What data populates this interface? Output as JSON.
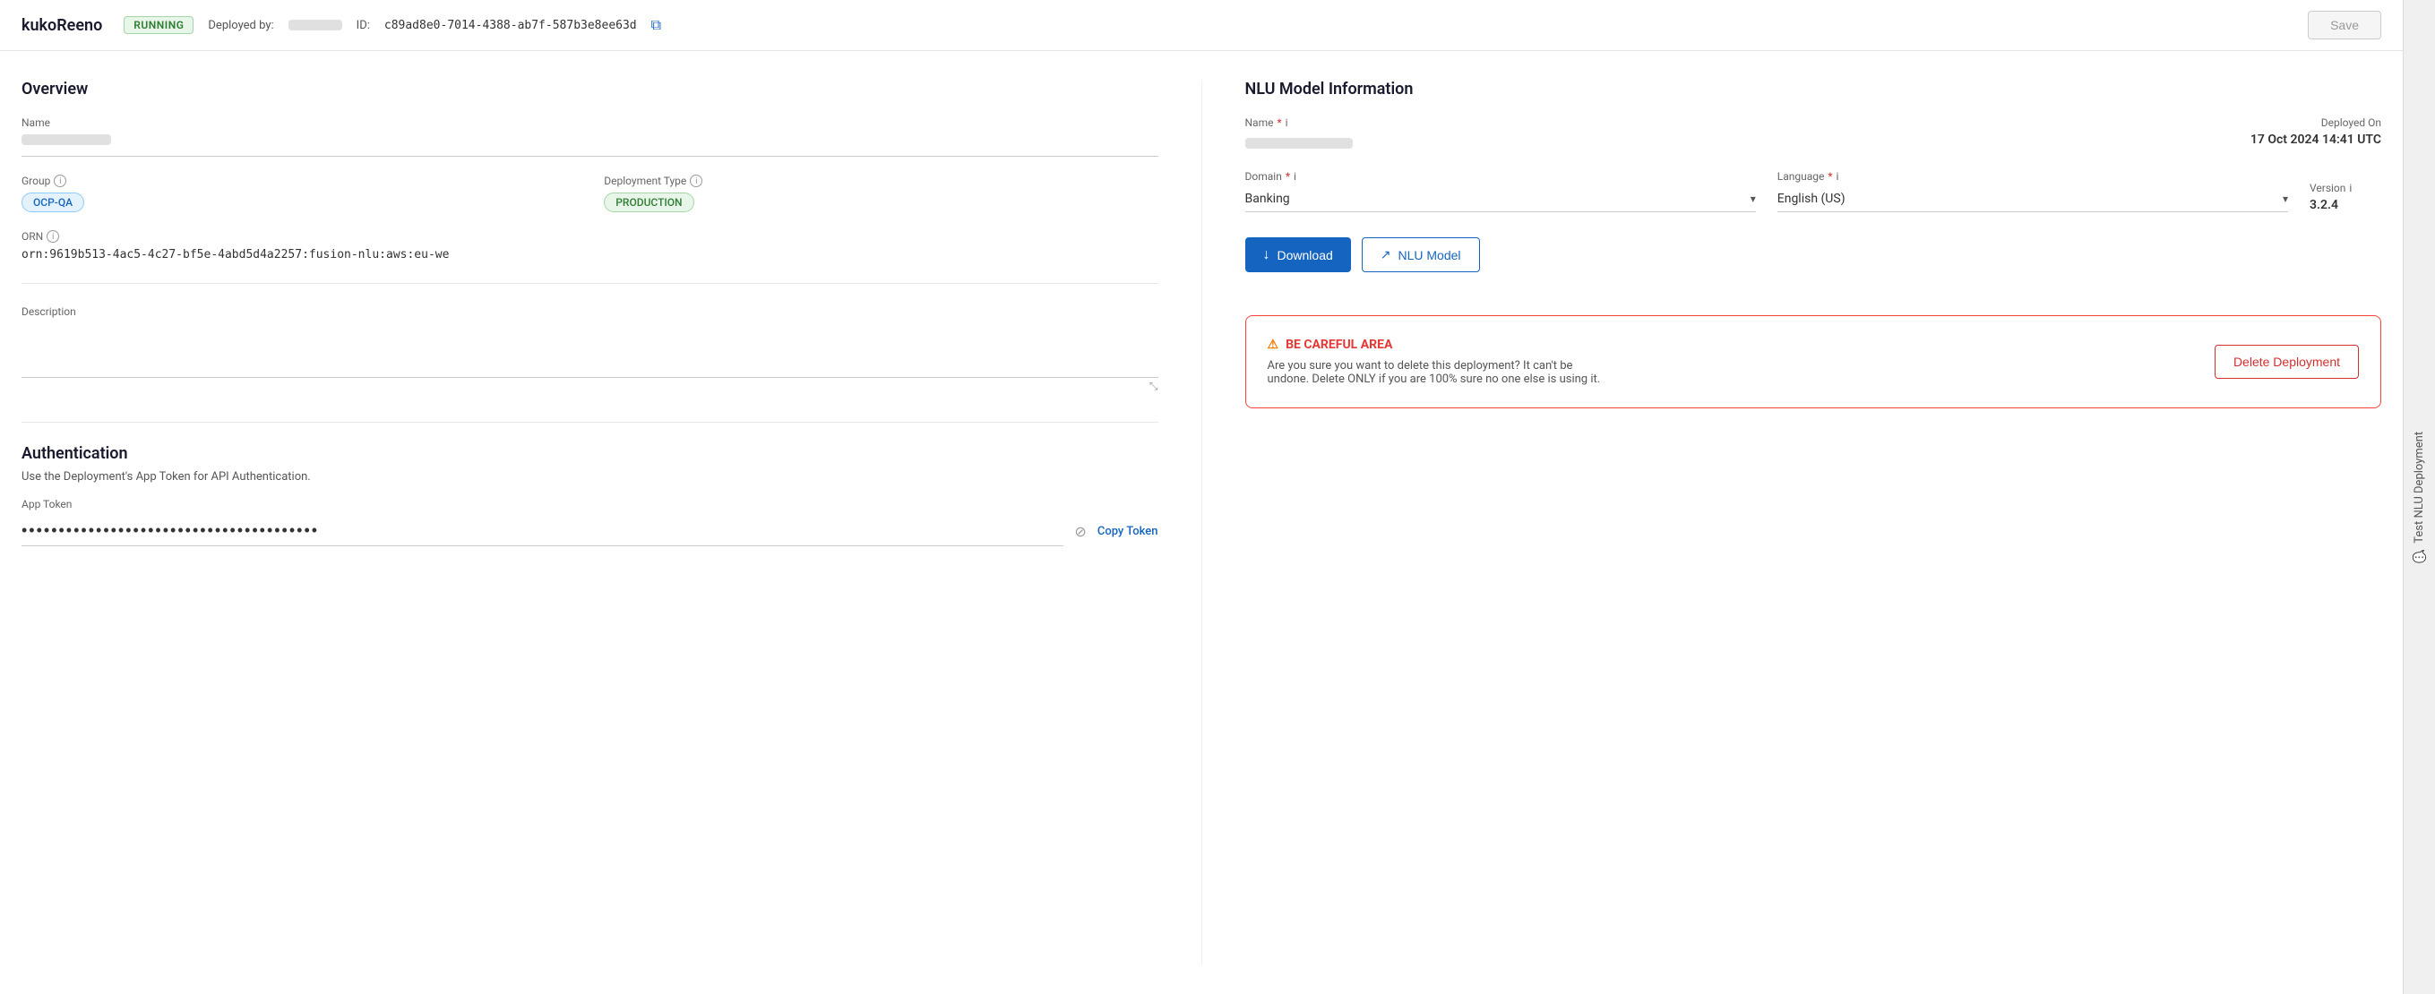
{
  "page": {
    "title": "kukoReeno",
    "sidebar_label": "Test NLU Deployment"
  },
  "top_bar": {
    "status": "RUNNING",
    "deployed_by_label": "Deployed by:",
    "id_label": "ID:",
    "id_value": "c89ad8e0-7014-4388-ab7f-587b3e8ee63d",
    "save_button": "Save"
  },
  "overview": {
    "section_title": "Overview",
    "name_label": "Name",
    "group_label": "Group",
    "group_info": "i",
    "group_value": "OCP-QA",
    "deployment_type_label": "Deployment Type",
    "deployment_type_info": "i",
    "deployment_type_value": "PRODUCTION",
    "orn_label": "ORN",
    "orn_info": "i",
    "orn_value": "orn:9619b513-4ac5-4c27-bf5e-4abd5d4a2257:fusion-nlu:aws:eu-we",
    "description_label": "Description"
  },
  "authentication": {
    "section_title": "Authentication",
    "description": "Use the Deployment's App Token for API Authentication.",
    "app_token_label": "App Token",
    "app_token_value": "••••••••••••••••••••••••••••••••••••••••",
    "copy_token_label": "Copy Token"
  },
  "nlu_model": {
    "section_title": "NLU Model Information",
    "name_label": "Name",
    "name_required": true,
    "name_info": "i",
    "deployed_on_label": "Deployed On",
    "deployed_on_value": "17 Oct 2024 14:41 UTC",
    "domain_label": "Domain",
    "domain_required": true,
    "domain_info": "i",
    "domain_value": "Banking",
    "language_label": "Language",
    "language_required": true,
    "language_info": "i",
    "language_value": "English (US)",
    "version_label": "Version",
    "version_info": "i",
    "version_value": "3.2.4",
    "download_button": "Download",
    "nlu_model_button": "NLU Model"
  },
  "danger_area": {
    "title": "BE CAREFUL AREA",
    "description": "Are you sure you want to delete this deployment? It can't be undone. Delete ONLY if you are 100% sure no one else is using it.",
    "delete_button": "Delete Deployment"
  },
  "icons": {
    "copy": "⧉",
    "eye_off": "⊘",
    "external_link": "↗",
    "download": "↓",
    "warning": "⚠",
    "chevron_down": "▾",
    "resize": "⤡",
    "info": "i",
    "chat": "💬"
  }
}
